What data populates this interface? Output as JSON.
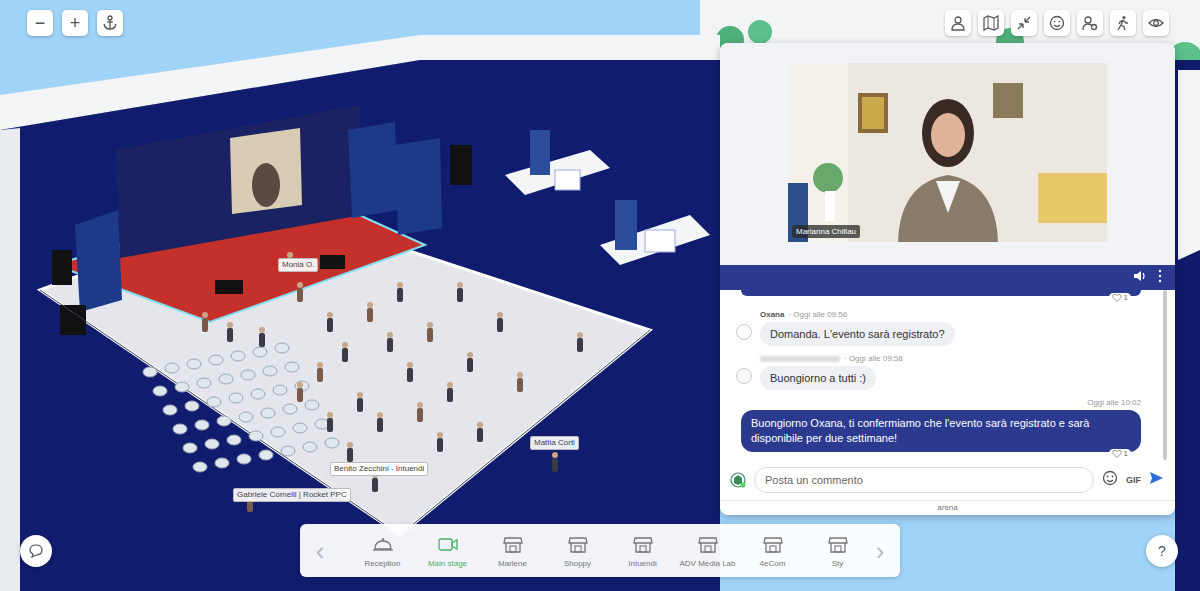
{
  "zoom_controls": [
    "−",
    "+"
  ],
  "scene": {
    "avatar_labels": [
      {
        "text": "Monia O."
      },
      {
        "text": "Mattia Corti"
      },
      {
        "text": "Benito Zecchini - Intuendi"
      },
      {
        "text": "Gabriele Cornelli | Rocket PPC"
      }
    ]
  },
  "chat_panel": {
    "video": {
      "speaker_name": "Marianna Chillau"
    },
    "messages": [
      {
        "kind": "cut",
        "likes": "1"
      },
      {
        "kind": "other",
        "author": "Oxana",
        "author_hidden": false,
        "time": "· Oggi alle 09:56",
        "text": "Domanda. L'evento sarà registrato?"
      },
      {
        "kind": "other",
        "author_hidden": true,
        "time": "· Oggi alle 09:58",
        "text": "Buongiorno a tutti :)"
      },
      {
        "kind": "own",
        "time": "Oggi alle 10:02",
        "text": "Buongiorno Oxana, ti confermiamo che l'evento sarà registrato e sarà disponibile per due settimane!",
        "likes": "1"
      }
    ],
    "composer": {
      "placeholder": "Posta un commento",
      "gif": "GIF"
    },
    "footer": "arena"
  },
  "location_bar": {
    "prev": "‹",
    "next": "›",
    "items": [
      {
        "label": "Reception",
        "kind": "bell",
        "selected": false
      },
      {
        "label": "Main stage",
        "kind": "camera",
        "selected": true
      },
      {
        "label": "Marlene",
        "kind": "shop",
        "selected": false
      },
      {
        "label": "Shoppy",
        "kind": "shop",
        "selected": false
      },
      {
        "label": "Intuendi",
        "kind": "shop",
        "selected": false
      },
      {
        "label": "ADV Media Lab",
        "kind": "shop",
        "selected": false
      },
      {
        "label": "4eCom",
        "kind": "shop",
        "selected": false
      },
      {
        "label": "Sty",
        "kind": "shop",
        "selected": false
      }
    ]
  },
  "help_button": "?"
}
